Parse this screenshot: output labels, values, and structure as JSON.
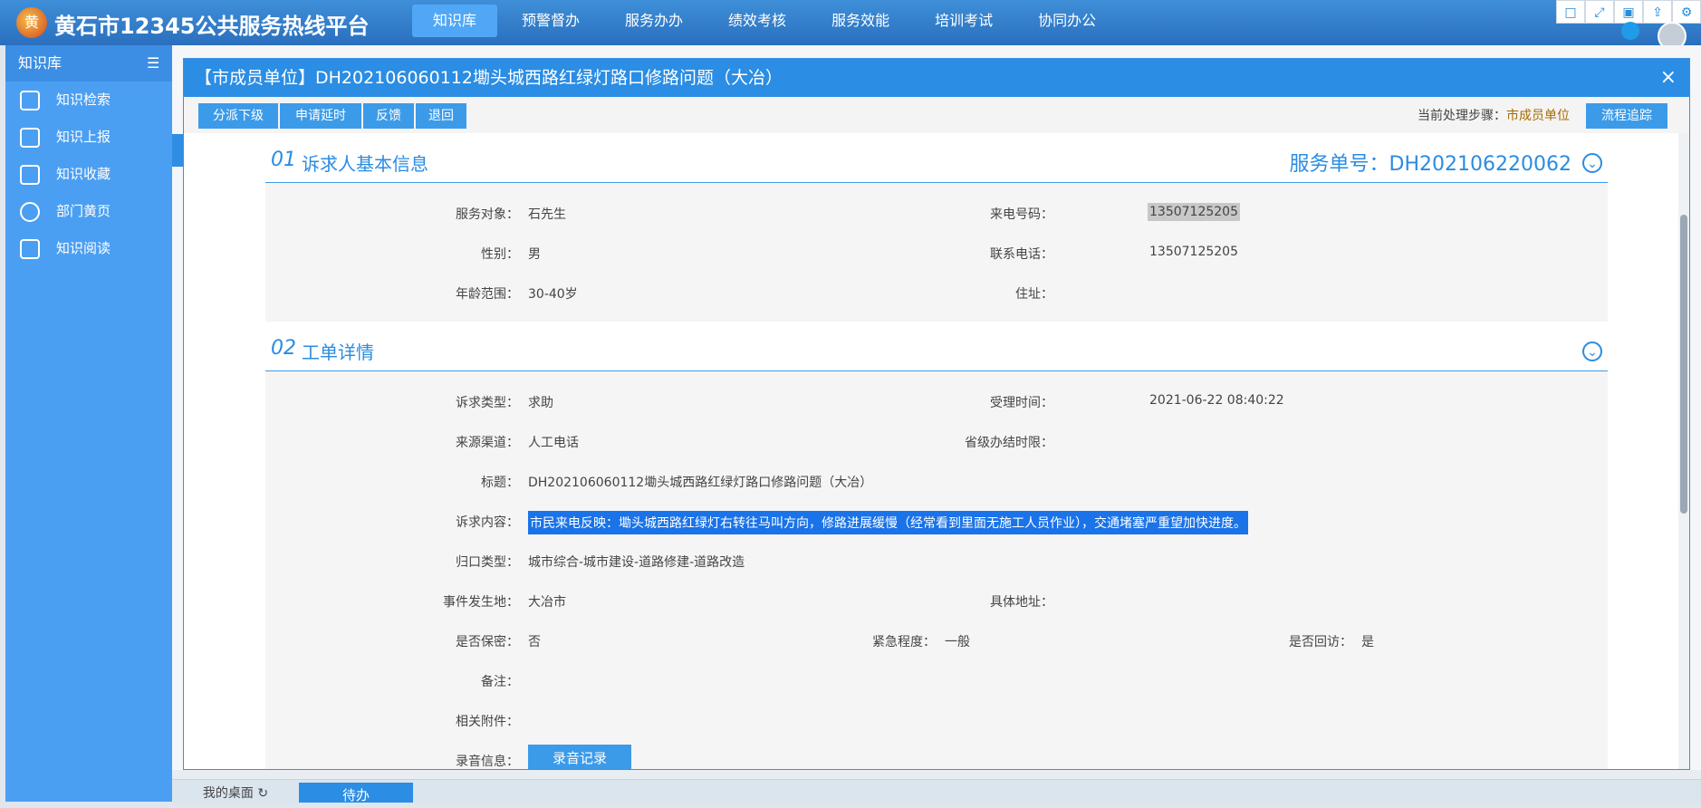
{
  "header": {
    "logo_char": "黄",
    "title": "黄石市12345公共服务热线平台",
    "nav": [
      {
        "label": "知识库",
        "active": true
      },
      {
        "label": "预警督办"
      },
      {
        "label": "服务办办"
      },
      {
        "label": "绩效考核"
      },
      {
        "label": "服务效能"
      },
      {
        "label": "培训考试"
      },
      {
        "label": "协同办公"
      }
    ],
    "window_icons": [
      "□",
      "⤢",
      "▣",
      "⇪",
      "⚙"
    ]
  },
  "sidebar": {
    "title": "知识库",
    "menu_icon": "☰",
    "items": [
      {
        "label": "知识检索",
        "icon": "search-doc-icon"
      },
      {
        "label": "知识上报",
        "icon": "upload-icon"
      },
      {
        "label": "知识收藏",
        "icon": "bookmark-icon"
      },
      {
        "label": "部门黄页",
        "icon": "person-icon"
      },
      {
        "label": "知识阅读",
        "icon": "book-icon"
      }
    ]
  },
  "modal": {
    "title": "【市成员单位】DH202106060112墈头城西路红绿灯路口修路问题（大冶）",
    "close": "×",
    "toolbar": {
      "buttons": [
        "分派下级",
        "申请延时",
        "反馈",
        "退回"
      ],
      "step_label": "当前处理步骤：",
      "step_value": "市成员单位",
      "trace_button": "流程追踪"
    },
    "section1": {
      "num": "01",
      "title": "诉求人基本信息",
      "service_no": "服务单号：DH202106220062",
      "chev": "⌄",
      "fields": {
        "target_label": "服务对象：",
        "target": "石先生",
        "incoming_label": "来电号码：",
        "incoming": "13507125205",
        "gender_label": "性别：",
        "gender": "男",
        "contact_label": "联系电话：",
        "contact": "13507125205",
        "age_label": "年龄范围：",
        "age": "30-40岁",
        "address_label": "住址：",
        "address": ""
      }
    },
    "section2": {
      "num": "02",
      "title": "工单详情",
      "chev": "⌄",
      "fields": {
        "type_label": "诉求类型：",
        "type": "求助",
        "accept_label": "受理时间：",
        "accept": "2021-06-22 08:40:22",
        "source_label": "来源渠道：",
        "source": "人工电话",
        "limit_label": "省级办结时限：",
        "limit": "",
        "subject_label": "标题：",
        "subject": "DH202106060112墈头城西路红绿灯路口修路问题（大冶）",
        "content_label": "诉求内容：",
        "content": "市民来电反映：墈头城西路红绿灯右转往马叫方向，修路进展缓慢（经常看到里面无施工人员作业），交通堵塞严重望加快进度。",
        "category_label": "归口类型：",
        "category": "城市综合-城市建设-道路修建-道路改造",
        "place_label": "事件发生地：",
        "place": "大冶市",
        "detail_addr_label": "具体地址：",
        "detail_addr": "",
        "secret_label": "是否保密：",
        "secret": "否",
        "urgency_label": "紧急程度：",
        "urgency": "一般",
        "revisit_label": "是否回访：",
        "revisit": "是",
        "remark_label": "备注：",
        "remark": "",
        "attach_label": "相关附件：",
        "attach": "",
        "record_label": "录音信息：",
        "record_button": "录音记录"
      }
    }
  },
  "bottom": {
    "tab1": "我的桌面",
    "tab1_icon": "↻",
    "tab2": "待办"
  }
}
